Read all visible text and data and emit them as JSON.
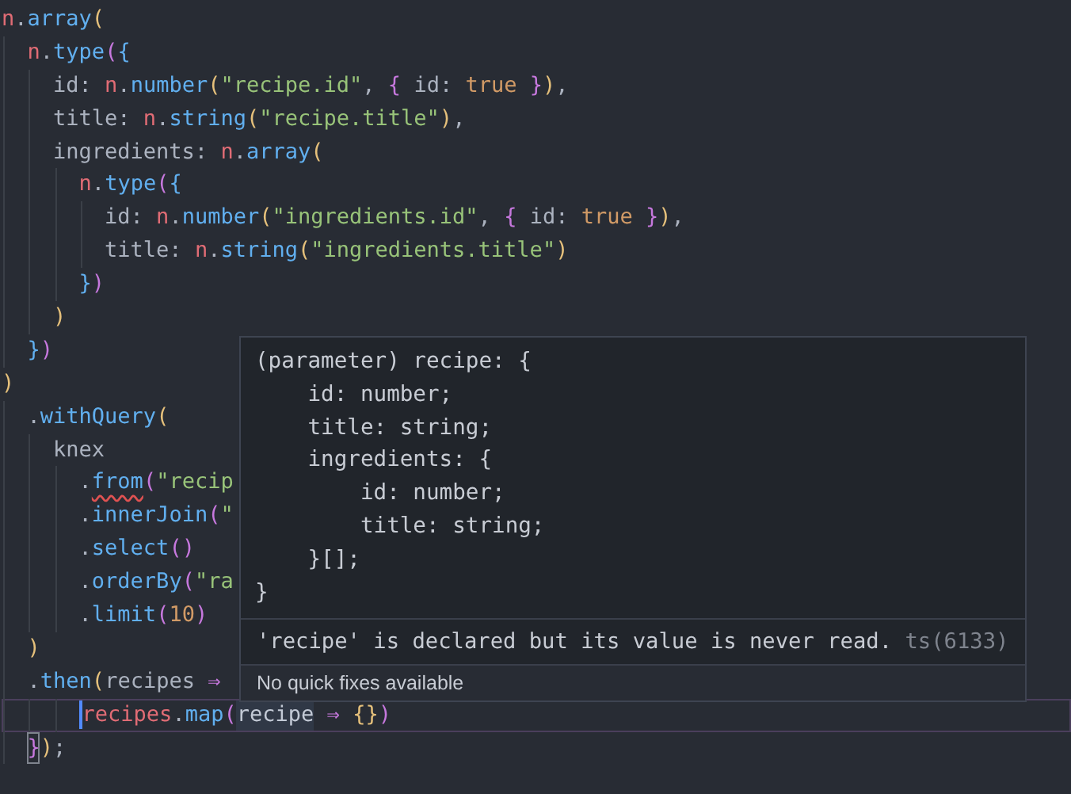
{
  "editor": {
    "lines": [
      {
        "tokens": [
          {
            "kind": "var",
            "text": "n"
          },
          {
            "kind": "plain",
            "text": "."
          },
          {
            "kind": "fn",
            "text": "array"
          },
          {
            "kind": "b1",
            "text": "("
          }
        ]
      },
      {
        "tokens": [
          {
            "kind": "var",
            "text": "  n"
          },
          {
            "kind": "plain",
            "text": "."
          },
          {
            "kind": "fn",
            "text": "type"
          },
          {
            "kind": "b2",
            "text": "("
          },
          {
            "kind": "b3",
            "text": "{"
          }
        ]
      },
      {
        "tokens": [
          {
            "kind": "plain",
            "text": "    id: "
          },
          {
            "kind": "var",
            "text": "n"
          },
          {
            "kind": "plain",
            "text": "."
          },
          {
            "kind": "fn",
            "text": "number"
          },
          {
            "kind": "b1",
            "text": "("
          },
          {
            "kind": "str",
            "text": "\"recipe.id\""
          },
          {
            "kind": "plain",
            "text": ", "
          },
          {
            "kind": "b2",
            "text": "{"
          },
          {
            "kind": "plain",
            "text": " id: "
          },
          {
            "kind": "const",
            "text": "true"
          },
          {
            "kind": "b2",
            "text": " }"
          },
          {
            "kind": "b1",
            "text": ")"
          },
          {
            "kind": "plain",
            "text": ","
          }
        ]
      },
      {
        "tokens": [
          {
            "kind": "plain",
            "text": "    title: "
          },
          {
            "kind": "var",
            "text": "n"
          },
          {
            "kind": "plain",
            "text": "."
          },
          {
            "kind": "fn",
            "text": "string"
          },
          {
            "kind": "b1",
            "text": "("
          },
          {
            "kind": "str",
            "text": "\"recipe.title\""
          },
          {
            "kind": "b1",
            "text": ")"
          },
          {
            "kind": "plain",
            "text": ","
          }
        ]
      },
      {
        "tokens": [
          {
            "kind": "plain",
            "text": "    ingredients: "
          },
          {
            "kind": "var",
            "text": "n"
          },
          {
            "kind": "plain",
            "text": "."
          },
          {
            "kind": "fn",
            "text": "array"
          },
          {
            "kind": "b1",
            "text": "("
          }
        ]
      },
      {
        "tokens": [
          {
            "kind": "var",
            "text": "      n"
          },
          {
            "kind": "plain",
            "text": "."
          },
          {
            "kind": "fn",
            "text": "type"
          },
          {
            "kind": "b2",
            "text": "("
          },
          {
            "kind": "b3",
            "text": "{"
          }
        ]
      },
      {
        "tokens": [
          {
            "kind": "plain",
            "text": "        id: "
          },
          {
            "kind": "var",
            "text": "n"
          },
          {
            "kind": "plain",
            "text": "."
          },
          {
            "kind": "fn",
            "text": "number"
          },
          {
            "kind": "b1",
            "text": "("
          },
          {
            "kind": "str",
            "text": "\"ingredients.id\""
          },
          {
            "kind": "plain",
            "text": ", "
          },
          {
            "kind": "b2",
            "text": "{"
          },
          {
            "kind": "plain",
            "text": " id: "
          },
          {
            "kind": "const",
            "text": "true"
          },
          {
            "kind": "b2",
            "text": " }"
          },
          {
            "kind": "b1",
            "text": ")"
          },
          {
            "kind": "plain",
            "text": ","
          }
        ]
      },
      {
        "tokens": [
          {
            "kind": "plain",
            "text": "        title: "
          },
          {
            "kind": "var",
            "text": "n"
          },
          {
            "kind": "plain",
            "text": "."
          },
          {
            "kind": "fn",
            "text": "string"
          },
          {
            "kind": "b1",
            "text": "("
          },
          {
            "kind": "str",
            "text": "\"ingredients.title\""
          },
          {
            "kind": "b1",
            "text": ")"
          }
        ]
      },
      {
        "tokens": [
          {
            "kind": "b3",
            "text": "      }"
          },
          {
            "kind": "b2",
            "text": ")"
          }
        ]
      },
      {
        "tokens": [
          {
            "kind": "b1",
            "text": "    )"
          }
        ]
      },
      {
        "tokens": [
          {
            "kind": "b3",
            "text": "  }"
          },
          {
            "kind": "b2",
            "text": ")"
          }
        ]
      },
      {
        "tokens": [
          {
            "kind": "b1",
            "text": ")"
          }
        ]
      },
      {
        "tokens": [
          {
            "kind": "plain",
            "text": "  ."
          },
          {
            "kind": "fn",
            "text": "withQuery"
          },
          {
            "kind": "b1",
            "text": "("
          }
        ]
      },
      {
        "tokens": [
          {
            "kind": "plain",
            "text": "    knex"
          }
        ]
      },
      {
        "tokens": [
          {
            "kind": "plain",
            "text": "      ."
          },
          {
            "kind": "fn",
            "text": "from",
            "squiggle": true
          },
          {
            "kind": "b2",
            "text": "("
          },
          {
            "kind": "str",
            "text": "\"recip"
          }
        ]
      },
      {
        "tokens": [
          {
            "kind": "plain",
            "text": "      ."
          },
          {
            "kind": "fn",
            "text": "innerJoin"
          },
          {
            "kind": "b2",
            "text": "("
          },
          {
            "kind": "str",
            "text": "\""
          }
        ]
      },
      {
        "tokens": [
          {
            "kind": "plain",
            "text": "      ."
          },
          {
            "kind": "fn",
            "text": "select"
          },
          {
            "kind": "b2",
            "text": "()"
          }
        ]
      },
      {
        "tokens": [
          {
            "kind": "plain",
            "text": "      ."
          },
          {
            "kind": "fn",
            "text": "orderBy"
          },
          {
            "kind": "b2",
            "text": "("
          },
          {
            "kind": "str",
            "text": "\"ra"
          }
        ]
      },
      {
        "tokens": [
          {
            "kind": "plain",
            "text": "      ."
          },
          {
            "kind": "fn",
            "text": "limit"
          },
          {
            "kind": "b2",
            "text": "("
          },
          {
            "kind": "const",
            "text": "10"
          },
          {
            "kind": "b2",
            "text": ")"
          }
        ]
      },
      {
        "tokens": [
          {
            "kind": "b1",
            "text": "  )"
          }
        ]
      },
      {
        "tokens": [
          {
            "kind": "plain",
            "text": "  ."
          },
          {
            "kind": "fn",
            "text": "then"
          },
          {
            "kind": "b1",
            "text": "("
          },
          {
            "kind": "plain",
            "text": "recipes "
          },
          {
            "kind": "arrow",
            "text": "⇒"
          }
        ]
      },
      {
        "current": true,
        "tokens": [
          {
            "kind": "var",
            "text": "      recipes",
            "cursor": true
          },
          {
            "kind": "plain",
            "text": "."
          },
          {
            "kind": "fn",
            "text": "map"
          },
          {
            "kind": "b2",
            "text": "("
          },
          {
            "kind": "plain",
            "text": "recipe",
            "highlight": true
          },
          {
            "kind": "arrow",
            "text": " ⇒"
          },
          {
            "kind": "b1",
            "text": " {}"
          },
          {
            "kind": "b2",
            "text": ")"
          }
        ]
      },
      {
        "tokens": [
          {
            "kind": "b2",
            "text": "  }",
            "match": true
          },
          {
            "kind": "b1",
            "text": ")"
          },
          {
            "kind": "plain",
            "text": ";"
          }
        ]
      }
    ]
  },
  "hover": {
    "signature": [
      "(parameter) recipe: {",
      "    id: number;",
      "    title: string;",
      "    ingredients: {",
      "        id: number;",
      "        title: string;",
      "    }[];",
      "}"
    ],
    "message": "'recipe' is declared but its value is never read.",
    "code": "ts(6133)",
    "quick_fix": "No quick fixes available"
  }
}
